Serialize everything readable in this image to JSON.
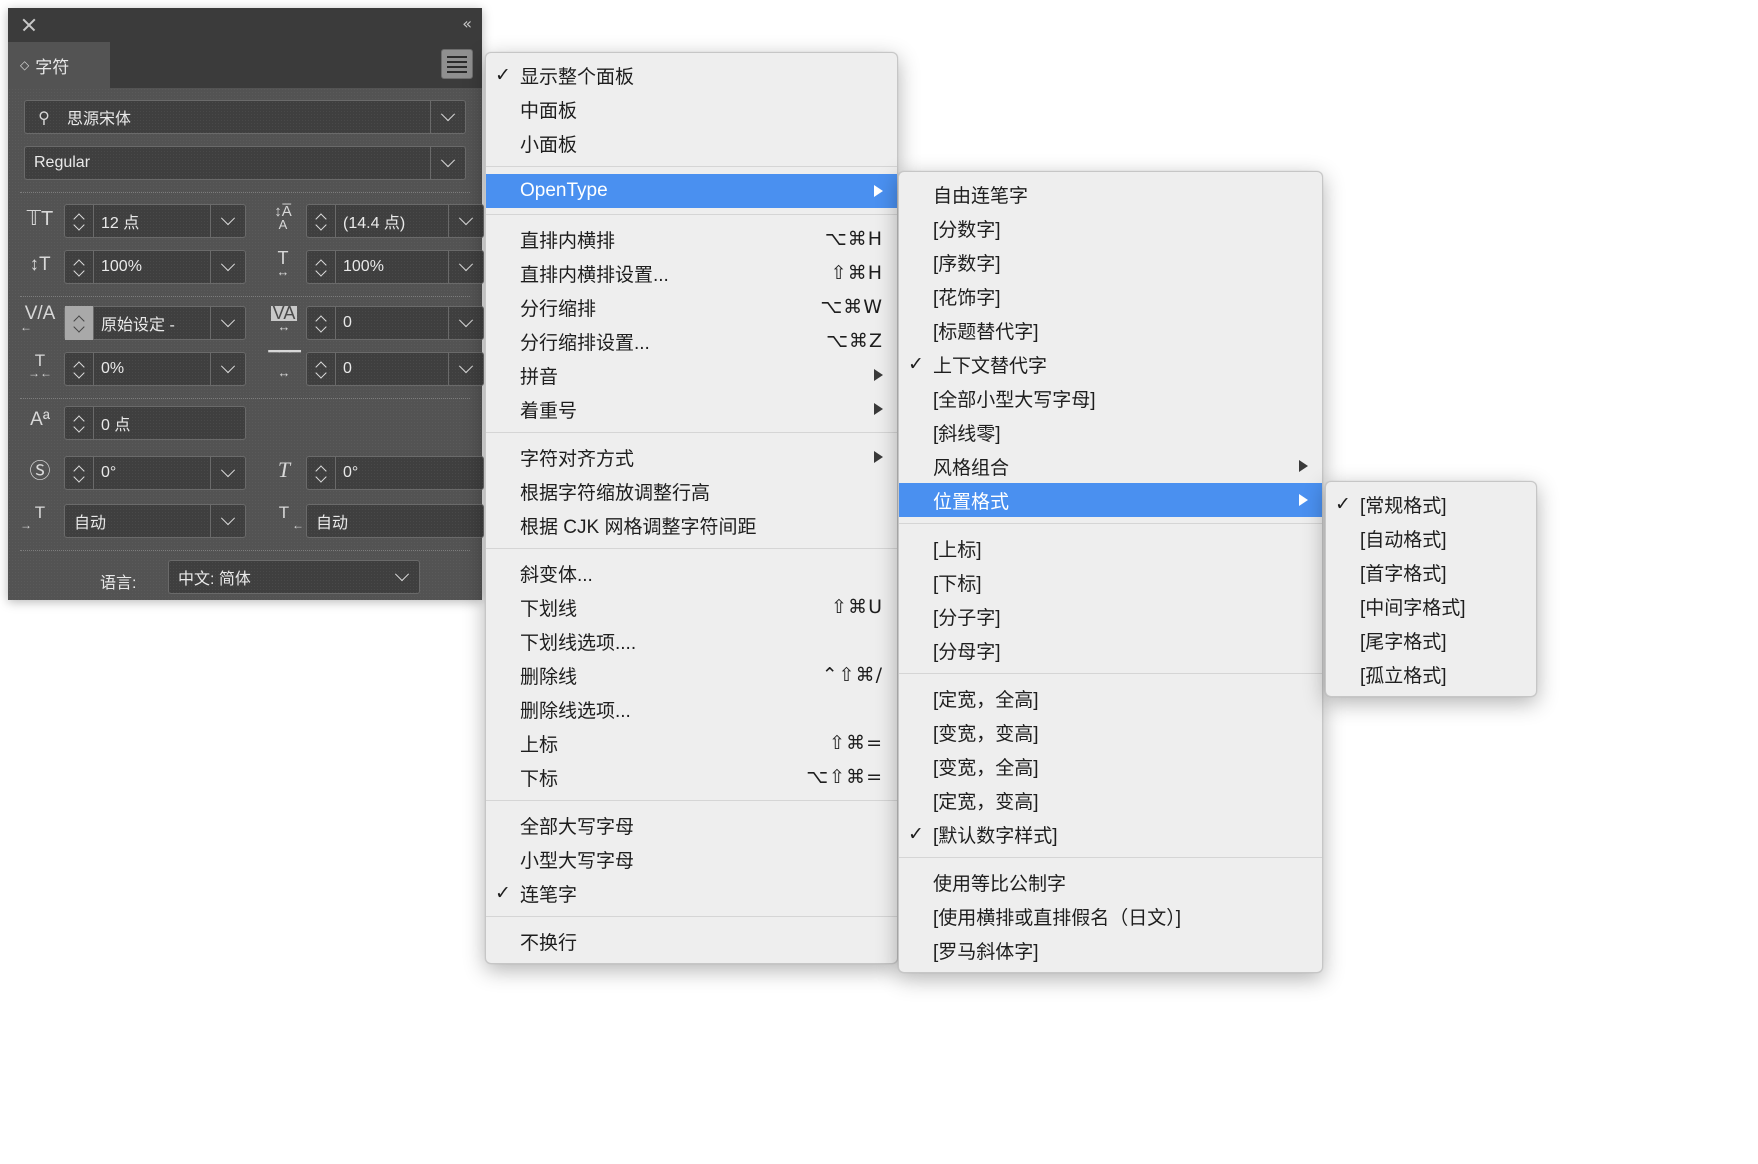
{
  "panel": {
    "title": "字符",
    "close_icon": "close-icon",
    "collapse_icon": "double-chevron-left-icon",
    "menu_icon": "hamburger-menu-icon",
    "font_family": "思源宋体",
    "font_family_icon": "font-search-icon",
    "font_style": "Regular",
    "font_size": "12 点",
    "leading": "(14.4 点)",
    "vertical_scale": "100%",
    "horizontal_scale": "100%",
    "kerning": "原始设定 -",
    "tracking": "0",
    "tsume": "0%",
    "aki": "0",
    "baseline_shift": "0 点",
    "character_rotation": "0°",
    "skew": "0°",
    "left_aki": "自动",
    "right_aki": "自动",
    "language_label": "语言:",
    "language_value": "中文: 简体"
  },
  "menu1": {
    "items": [
      {
        "label": "显示整个面板",
        "checked": true,
        "shortcut": "",
        "submenu": false
      },
      {
        "label": "中面板",
        "checked": false,
        "shortcut": "",
        "submenu": false
      },
      {
        "label": "小面板",
        "checked": false,
        "shortcut": "",
        "submenu": false
      },
      {
        "separator": true
      },
      {
        "label": "OpenType",
        "checked": false,
        "shortcut": "",
        "submenu": true,
        "selected": true
      },
      {
        "separator": true
      },
      {
        "label": "直排内横排",
        "checked": false,
        "shortcut": "⌥⌘H",
        "submenu": false
      },
      {
        "label": "直排内横排设置...",
        "checked": false,
        "shortcut": "⇧⌘H",
        "submenu": false
      },
      {
        "label": "分行缩排",
        "checked": false,
        "shortcut": "⌥⌘W",
        "submenu": false
      },
      {
        "label": "分行缩排设置...",
        "checked": false,
        "shortcut": "⌥⌘Z",
        "submenu": false
      },
      {
        "label": "拼音",
        "checked": false,
        "shortcut": "",
        "submenu": true
      },
      {
        "label": "着重号",
        "checked": false,
        "shortcut": "",
        "submenu": true
      },
      {
        "separator": true
      },
      {
        "label": "字符对齐方式",
        "checked": false,
        "shortcut": "",
        "submenu": true
      },
      {
        "label": "根据字符缩放调整行高",
        "checked": false,
        "shortcut": "",
        "submenu": false
      },
      {
        "label": "根据 CJK 网格调整字符间距",
        "checked": false,
        "shortcut": "",
        "submenu": false
      },
      {
        "separator": true
      },
      {
        "label": "斜变体...",
        "checked": false,
        "shortcut": "",
        "submenu": false
      },
      {
        "label": "下划线",
        "checked": false,
        "shortcut": "⇧⌘U",
        "submenu": false
      },
      {
        "label": "下划线选项....",
        "checked": false,
        "shortcut": "",
        "submenu": false
      },
      {
        "label": "删除线",
        "checked": false,
        "shortcut": "⌃⇧⌘/",
        "submenu": false
      },
      {
        "label": "删除线选项...",
        "checked": false,
        "shortcut": "",
        "submenu": false
      },
      {
        "label": "上标",
        "checked": false,
        "shortcut": "⇧⌘=",
        "submenu": false
      },
      {
        "label": "下标",
        "checked": false,
        "shortcut": "⌥⇧⌘=",
        "submenu": false
      },
      {
        "separator": true
      },
      {
        "label": "全部大写字母",
        "checked": false,
        "shortcut": "",
        "submenu": false
      },
      {
        "label": "小型大写字母",
        "checked": false,
        "shortcut": "",
        "submenu": false
      },
      {
        "label": "连笔字",
        "checked": true,
        "shortcut": "",
        "submenu": false
      },
      {
        "separator": true
      },
      {
        "label": "不换行",
        "checked": false,
        "shortcut": "",
        "submenu": false
      }
    ]
  },
  "menu2": {
    "items": [
      {
        "label": "自由连笔字",
        "checked": false,
        "submenu": false
      },
      {
        "label": "[分数字]",
        "checked": false,
        "submenu": false
      },
      {
        "label": "[序数字]",
        "checked": false,
        "submenu": false
      },
      {
        "label": "[花饰字]",
        "checked": false,
        "submenu": false
      },
      {
        "label": "[标题替代字]",
        "checked": false,
        "submenu": false
      },
      {
        "label": "上下文替代字",
        "checked": true,
        "submenu": false
      },
      {
        "label": "[全部小型大写字母]",
        "checked": false,
        "submenu": false
      },
      {
        "label": "[斜线零]",
        "checked": false,
        "submenu": false
      },
      {
        "label": "风格组合",
        "checked": false,
        "submenu": true
      },
      {
        "label": "位置格式",
        "checked": false,
        "submenu": true,
        "selected": true
      },
      {
        "separator": true
      },
      {
        "label": "[上标]",
        "checked": false,
        "submenu": false
      },
      {
        "label": "[下标]",
        "checked": false,
        "submenu": false
      },
      {
        "label": "[分子字]",
        "checked": false,
        "submenu": false
      },
      {
        "label": "[分母字]",
        "checked": false,
        "submenu": false
      },
      {
        "separator": true
      },
      {
        "label": "[定宽，全高]",
        "checked": false,
        "submenu": false
      },
      {
        "label": "[变宽，变高]",
        "checked": false,
        "submenu": false
      },
      {
        "label": "[变宽，全高]",
        "checked": false,
        "submenu": false
      },
      {
        "label": "[定宽，变高]",
        "checked": false,
        "submenu": false
      },
      {
        "label": "[默认数字样式]",
        "checked": true,
        "submenu": false
      },
      {
        "separator": true
      },
      {
        "label": "使用等比公制字",
        "checked": false,
        "submenu": false
      },
      {
        "label": "[使用横排或直排假名（日文）]",
        "checked": false,
        "submenu": false
      },
      {
        "label": "[罗马斜体字]",
        "checked": false,
        "submenu": false
      }
    ]
  },
  "menu3": {
    "items": [
      {
        "label": "[常规格式]",
        "checked": true,
        "submenu": false
      },
      {
        "label": "[自动格式]",
        "checked": false,
        "submenu": false
      },
      {
        "label": "[首字格式]",
        "checked": false,
        "submenu": false
      },
      {
        "label": "[中间字格式]",
        "checked": false,
        "submenu": false
      },
      {
        "label": "[尾字格式]",
        "checked": false,
        "submenu": false
      },
      {
        "label": "[孤立格式]",
        "checked": false,
        "submenu": false
      }
    ]
  },
  "colors": {
    "panel_bg": "#535353",
    "panel_header": "#3b3b3b",
    "menu_bg": "#eeeeee",
    "highlight": "#4a90f0",
    "text_light": "#e9e9e9",
    "text_dark": "#1e1e1e"
  }
}
